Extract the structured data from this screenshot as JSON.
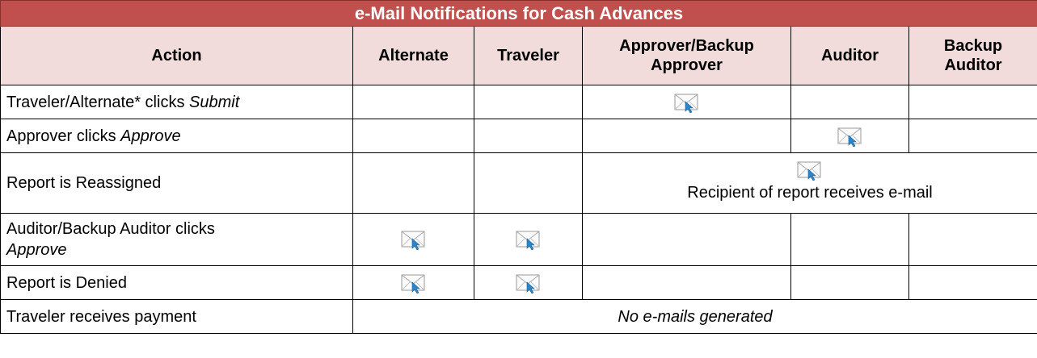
{
  "title": "e-Mail Notifications for Cash Advances",
  "columns": [
    "Action",
    "Alternate",
    "Traveler",
    "Approver/Backup Approver",
    "Auditor",
    "Backup Auditor"
  ],
  "rows": [
    {
      "action_prefix": "Traveler/Alternate* clicks ",
      "action_emph": "Submit",
      "notify": [
        "",
        "",
        "mail",
        "",
        ""
      ]
    },
    {
      "action_prefix": "Approver clicks ",
      "action_emph": "Approve",
      "notify": [
        "",
        "",
        "",
        "mail",
        ""
      ]
    },
    {
      "action_prefix": "Report is Reassigned",
      "action_emph": "",
      "span_note": "Recipient of report receives e-mail"
    },
    {
      "action_prefix": "Auditor/Backup Auditor clicks ",
      "action_emph": "Approve",
      "notify": [
        "mail",
        "mail",
        "",
        "",
        ""
      ]
    },
    {
      "action_prefix": "Report is Denied",
      "action_emph": "",
      "notify": [
        "mail",
        "mail",
        "",
        "",
        ""
      ]
    },
    {
      "action_prefix": "Traveler receives payment",
      "action_emph": "",
      "no_mail_note": "No e-mails generated"
    }
  ],
  "icon": "email-notification-icon"
}
